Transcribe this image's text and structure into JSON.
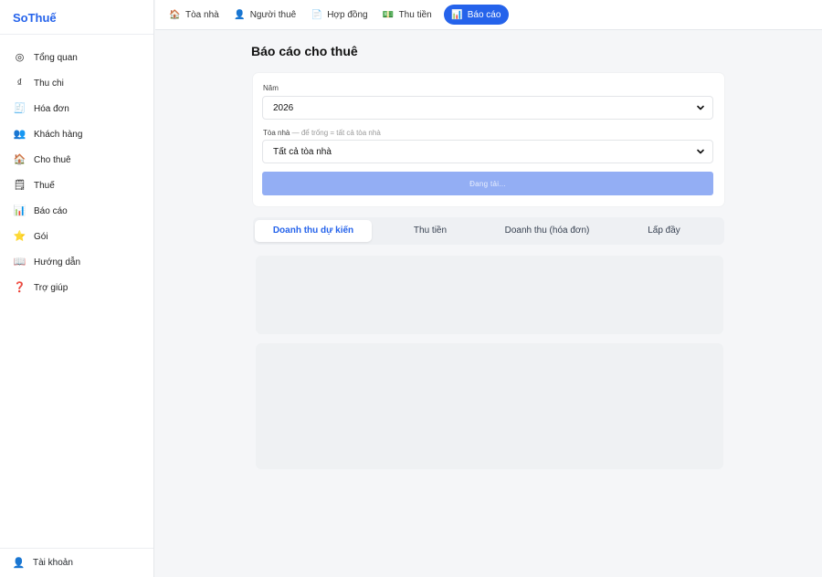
{
  "app": {
    "brand": "SoThuế"
  },
  "sidebar": {
    "items": [
      {
        "label": "Tổng quan",
        "icon": "overview-circle-icon",
        "glyph": "◎"
      },
      {
        "label": "Thu chi",
        "icon": "dong-currency-icon",
        "glyph": "₫"
      },
      {
        "label": "Hóa đơn",
        "icon": "invoice-icon",
        "glyph": "🧾"
      },
      {
        "label": "Khách hàng",
        "icon": "customers-icon",
        "glyph": "👥"
      },
      {
        "label": "Cho thuê",
        "icon": "house-icon",
        "glyph": "🏠"
      },
      {
        "label": "Thuế",
        "icon": "ledger-icon",
        "glyph": "🗒"
      },
      {
        "label": "Báo cáo",
        "icon": "bar-chart-icon",
        "glyph": "📊"
      },
      {
        "label": "Gói",
        "icon": "star-icon",
        "glyph": "⭐"
      },
      {
        "label": "Hướng dẫn",
        "icon": "book-icon",
        "glyph": "📖"
      },
      {
        "label": "Trợ giúp",
        "icon": "question-icon",
        "glyph": "❓"
      }
    ],
    "footer": {
      "label": "Tài khoản",
      "icon": "user-icon",
      "glyph": "👤"
    }
  },
  "topbar": {
    "tabs": [
      {
        "label": "Tòa nhà",
        "icon": "building-icon",
        "glyph": "🏠"
      },
      {
        "label": "Người thuê",
        "icon": "tenant-icon",
        "glyph": "👤"
      },
      {
        "label": "Hợp đồng",
        "icon": "contract-icon",
        "glyph": "📄"
      },
      {
        "label": "Thu tiền",
        "icon": "money-icon",
        "glyph": "💵"
      },
      {
        "label": "Báo cáo",
        "icon": "report-icon",
        "glyph": "📊",
        "active": true
      }
    ]
  },
  "page": {
    "title": "Báo cáo cho thuê",
    "year_label": "Năm",
    "year_value": "2026",
    "building_label": "Tòa nhà",
    "building_hint": "— để trống = tất cả tòa nhà",
    "building_value": "Tất cả tòa nhà",
    "submit_label": "Đang tải..."
  },
  "report_tabs": [
    {
      "label": "Doanh thu dự kiến",
      "active": true
    },
    {
      "label": "Thu tiền"
    },
    {
      "label": "Doanh thu (hóa đơn)"
    },
    {
      "label": "Lấp đầy"
    }
  ],
  "colors": {
    "accent": "#2563eb",
    "button_loading": "#93aef4"
  }
}
